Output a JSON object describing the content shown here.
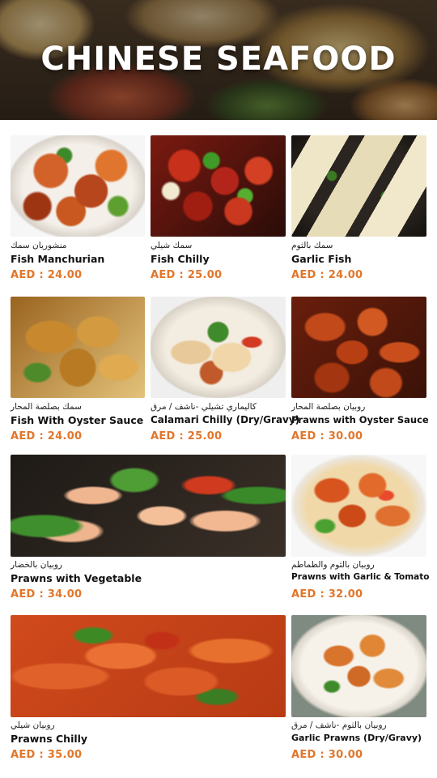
{
  "header": {
    "title": "CHINESE SEAFOOD"
  },
  "colors": {
    "price": "#e2762a",
    "title": "#ffffff",
    "text": "#111111"
  },
  "items": [
    {
      "arabic": "منشوريان سمك",
      "name": "Fish Manchurian",
      "price": "AED : 24.00"
    },
    {
      "arabic": "سمك شيلي",
      "name": "Fish Chilly",
      "price": "AED : 25.00"
    },
    {
      "arabic": "سمك بالثوم",
      "name": "Garlic Fish",
      "price": "AED : 24.00"
    },
    {
      "arabic": "سمك بصلصة المحار",
      "name": "Fish With Oyster Sauce",
      "price": "AED : 24.00"
    },
    {
      "arabic": "كاليماري تشيلي -ناشف / مرق",
      "name": "Calamari Chilly (Dry/Gravy)",
      "price": "AED : 25.00"
    },
    {
      "arabic": "روبيان بصلصة المحار",
      "name": "Prawns with Oyster Sauce",
      "price": "AED : 30.00"
    },
    {
      "arabic": "روبيان بالخضار",
      "name": "Prawns with Vegetable",
      "price": "AED : 34.00"
    },
    {
      "arabic": "روبيان بالثوم والطماطم",
      "name": "Prawns with Garlic & Tomato",
      "price": "AED : 32.00"
    },
    {
      "arabic": "روبيان شيلي",
      "name": "Prawns Chilly",
      "price": "AED : 35.00"
    },
    {
      "arabic": "روبيان بالثوم -ناشف / مرق",
      "name": "Garlic Prawns (Dry/Gravy)",
      "price": "AED : 30.00"
    }
  ]
}
